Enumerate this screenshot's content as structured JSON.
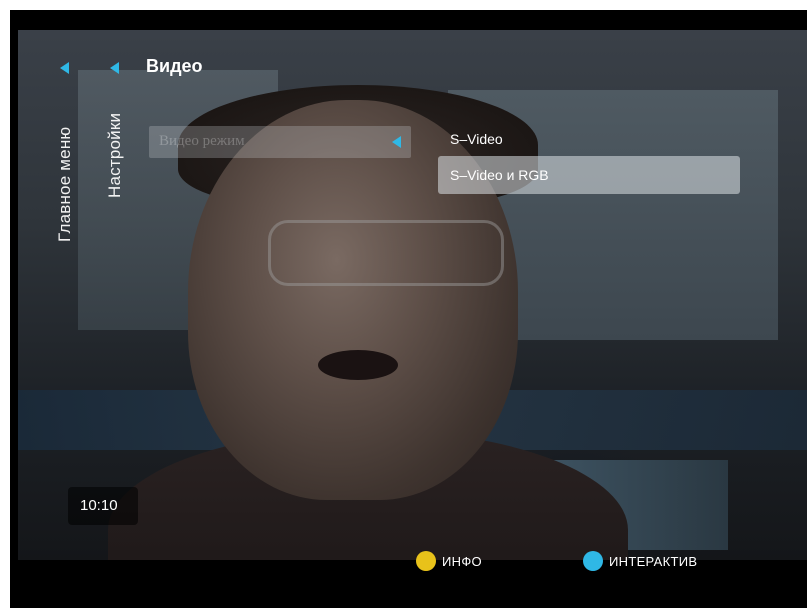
{
  "nav": {
    "main_menu": "Главное меню",
    "settings": "Настройки"
  },
  "page": {
    "title": "Видео"
  },
  "setting": {
    "label": "Видео режим"
  },
  "options": [
    {
      "label": "S–Video",
      "selected": false
    },
    {
      "label": "S–Video и RGB",
      "selected": true
    }
  ],
  "clock": "10:10",
  "footer": {
    "info": {
      "label": "ИНФО",
      "color": "#e8c21a"
    },
    "interactive": {
      "label": "ИНТЕРАКТИВ",
      "color": "#2fb8e6"
    }
  },
  "colors": {
    "accent": "#2fb8e6",
    "background": "#000000"
  },
  "icons": [
    "back-arrow-icon",
    "left-arrow-icon",
    "yellow-key-icon",
    "blue-key-icon"
  ]
}
